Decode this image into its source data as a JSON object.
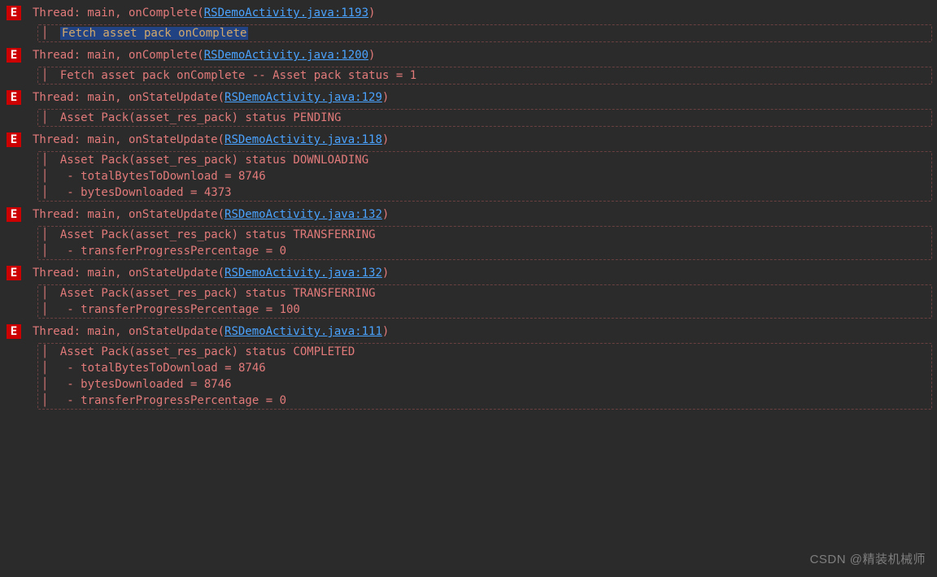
{
  "badge": "E",
  "watermark": "CSDN @精装机械师",
  "entries": [
    {
      "prefix": "Thread: main, onComplete(",
      "link": "RSDemoActivity.java:1193",
      "suffix": ")",
      "lines": [
        {
          "text": "Fetch asset pack onComplete",
          "highlight": true
        }
      ]
    },
    {
      "prefix": "Thread: main, onComplete(",
      "link": "RSDemoActivity.java:1200",
      "suffix": ")",
      "lines": [
        {
          "text": "Fetch asset pack onComplete -- Asset pack status = 1"
        }
      ]
    },
    {
      "prefix": "Thread: main, onStateUpdate(",
      "link": "RSDemoActivity.java:129",
      "suffix": ")",
      "lines": [
        {
          "text": "Asset Pack(asset_res_pack) status PENDING"
        }
      ]
    },
    {
      "prefix": "Thread: main, onStateUpdate(",
      "link": "RSDemoActivity.java:118",
      "suffix": ")",
      "lines": [
        {
          "text": "Asset Pack(asset_res_pack) status DOWNLOADING"
        },
        {
          "text": " - totalBytesToDownload = 8746"
        },
        {
          "text": " - bytesDownloaded = 4373"
        }
      ]
    },
    {
      "prefix": "Thread: main, onStateUpdate(",
      "link": "RSDemoActivity.java:132",
      "suffix": ")",
      "lines": [
        {
          "text": "Asset Pack(asset_res_pack) status TRANSFERRING"
        },
        {
          "text": " - transferProgressPercentage = 0"
        }
      ]
    },
    {
      "prefix": "Thread: main, onStateUpdate(",
      "link": "RSDemoActivity.java:132",
      "suffix": ")",
      "lines": [
        {
          "text": "Asset Pack(asset_res_pack) status TRANSFERRING"
        },
        {
          "text": " - transferProgressPercentage = 100"
        }
      ]
    },
    {
      "prefix": "Thread: main, onStateUpdate(",
      "link": "RSDemoActivity.java:111",
      "suffix": ")",
      "lines": [
        {
          "text": "Asset Pack(asset_res_pack) status COMPLETED"
        },
        {
          "text": " - totalBytesToDownload = 8746"
        },
        {
          "text": " - bytesDownloaded = 8746"
        },
        {
          "text": " - transferProgressPercentage = 0"
        }
      ]
    }
  ]
}
